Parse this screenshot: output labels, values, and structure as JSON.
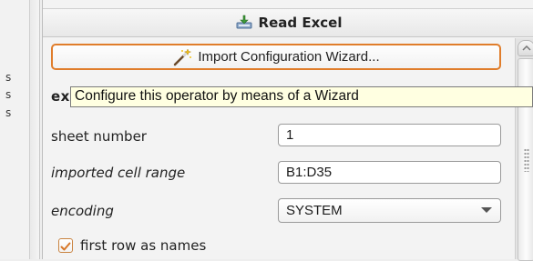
{
  "left_panel": {
    "fragments": [
      "s",
      "s",
      "s"
    ]
  },
  "header": {
    "title": "Read Excel",
    "icon": "read-excel-operator-icon"
  },
  "wizard_button": {
    "label": "Import Configuration Wizard...",
    "icon": "magic-wand-icon"
  },
  "tooltip": {
    "text": "Configure this operator by means of a Wizard"
  },
  "parameters": {
    "excel_file_label_fragment": "ex",
    "sheet_number": {
      "label": "sheet number",
      "value": "1"
    },
    "imported_cell_range": {
      "label": "imported cell range",
      "value": "B1:D35"
    },
    "encoding": {
      "label": "encoding",
      "value": "SYSTEM"
    },
    "first_row_as_names": {
      "label": "first row as names",
      "checked": true
    }
  },
  "colors": {
    "accent_orange": "#e07d2b",
    "tooltip_bg": "#ffffe1",
    "panel_bg": "#f3f3f3"
  }
}
